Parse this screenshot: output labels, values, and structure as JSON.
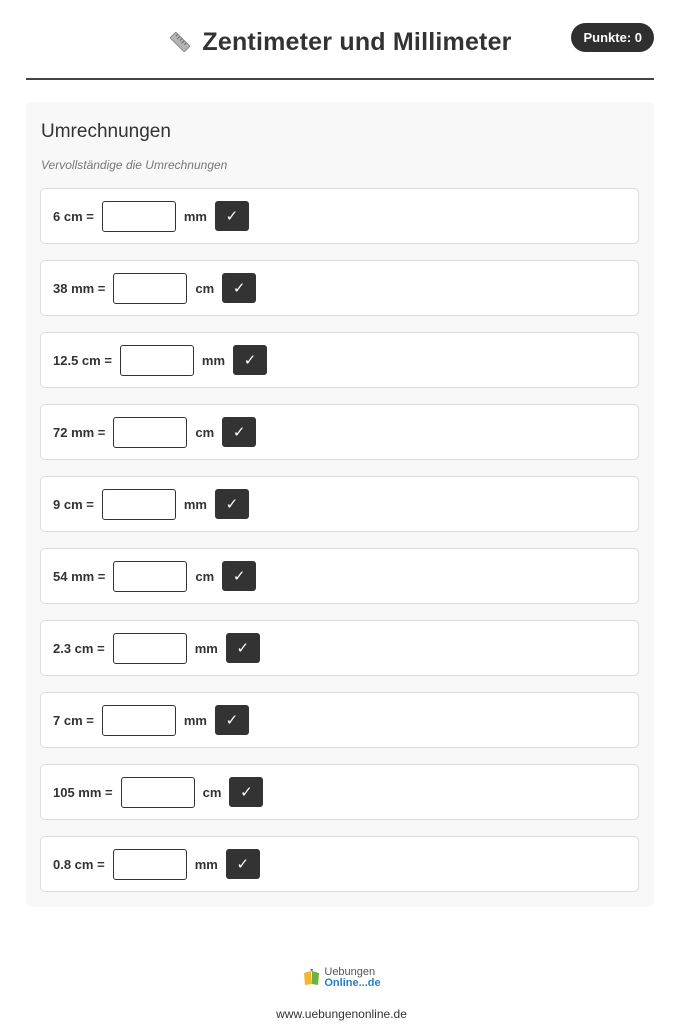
{
  "header": {
    "title": "Zentimeter und Millimeter",
    "title_icon": "ruler-icon",
    "score": "Punkte: 0"
  },
  "section": {
    "title": "Umrechnungen",
    "instruction": "Vervollständige die Umrechnungen"
  },
  "tasks": [
    {
      "label": "6 cm =",
      "unit": "mm",
      "value": "",
      "button": "✓"
    },
    {
      "label": "38 mm =",
      "unit": "cm",
      "value": "",
      "button": "✓"
    },
    {
      "label": "12.5 cm =",
      "unit": "mm",
      "value": "",
      "button": "✓"
    },
    {
      "label": "72 mm =",
      "unit": "cm",
      "value": "",
      "button": "✓"
    },
    {
      "label": "9 cm =",
      "unit": "mm",
      "value": "",
      "button": "✓"
    },
    {
      "label": "54 mm =",
      "unit": "cm",
      "value": "",
      "button": "✓"
    },
    {
      "label": "2.3 cm =",
      "unit": "mm",
      "value": "",
      "button": "✓"
    },
    {
      "label": "7 cm =",
      "unit": "mm",
      "value": "",
      "button": "✓"
    },
    {
      "label": "105 mm =",
      "unit": "cm",
      "value": "",
      "button": "✓"
    },
    {
      "label": "0.8 cm =",
      "unit": "mm",
      "value": "",
      "button": "✓"
    }
  ],
  "footer": {
    "logo_line1": "Uebungen",
    "logo_line2": "Online...de",
    "url": "www.uebungenonline.de"
  },
  "colors": {
    "dark": "#333333",
    "panel_bg": "#f8f8f8",
    "logo_blue": "#2a7fc1"
  }
}
